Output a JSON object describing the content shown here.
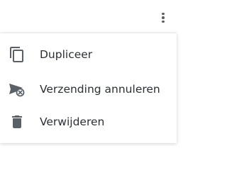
{
  "header": {
    "more_icon": "more-vertical-icon"
  },
  "menu": {
    "items": [
      {
        "label": "Dupliceer",
        "icon": "copy-icon"
      },
      {
        "label": "Verzending annuleren",
        "icon": "cancel-send-icon"
      },
      {
        "label": "Verwijderen",
        "icon": "trash-icon"
      }
    ]
  },
  "colors": {
    "icon": "#5a6068",
    "text": "#2b2f35",
    "background": "#ffffff"
  }
}
